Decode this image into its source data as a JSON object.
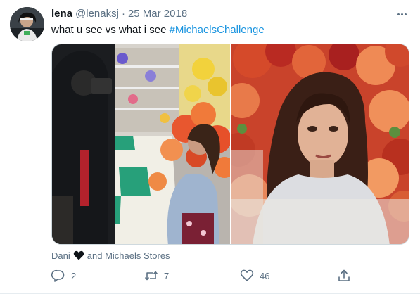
{
  "tweet": {
    "display_name": "lena",
    "handle": "@lenaksj",
    "separator": "·",
    "date": "25 Mar 2018",
    "text_prefix": "what u see vs what i see ",
    "hashtag": "#MichaelsChallenge",
    "tagged": {
      "first": "Dani",
      "joiner": "and",
      "second": "Michaels Stores"
    },
    "counts": {
      "replies": "2",
      "retweets": "7",
      "likes": "46"
    }
  },
  "icons": {
    "more": "more-horizontal-icon",
    "tag_heart": "black-heart-icon",
    "reply": "reply-icon",
    "retweet": "retweet-icon",
    "like": "heart-outline-icon",
    "share": "share-icon"
  },
  "colors": {
    "text_primary": "#0f1419",
    "text_secondary": "#5b7083",
    "link": "#1b95e0",
    "border": "#cfd9de"
  }
}
